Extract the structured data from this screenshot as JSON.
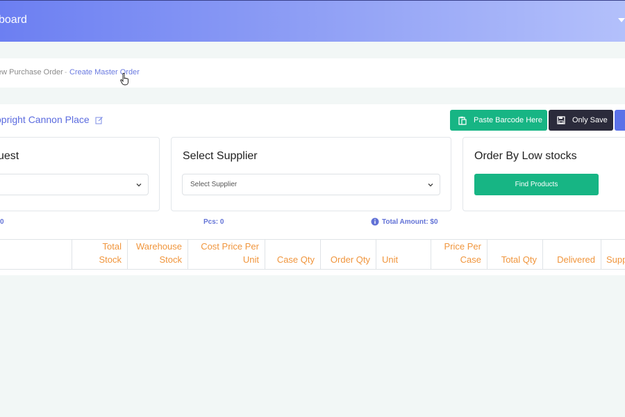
{
  "header": {
    "title": "board"
  },
  "breadcrumb": {
    "items": [
      {
        "label": "ew Purchase Order"
      },
      {
        "label": "Create Master Order"
      }
    ],
    "separator": "-"
  },
  "order": {
    "store_name": "opright Cannon Place",
    "buttons": {
      "paste_barcode": "Paste Barcode Here",
      "only_save": "Only Save"
    },
    "panels": {
      "request": {
        "title": "uest"
      },
      "supplier": {
        "title": "Select Supplier",
        "placeholder": "Select Supplier"
      },
      "low_stock": {
        "title": "Order By Low stocks",
        "button": "Find Products"
      }
    },
    "stats": {
      "first": "0",
      "pcs": "Pcs: 0",
      "total_amount": "Total Amount: $0"
    }
  },
  "table": {
    "columns": [
      {
        "line1": "",
        "line2": ""
      },
      {
        "line1": "Total",
        "line2": "Stock"
      },
      {
        "line1": "Warehouse",
        "line2": "Stock"
      },
      {
        "line1": "Cost Price Per",
        "line2": "Unit"
      },
      {
        "line1": "",
        "line2": "Case Qty"
      },
      {
        "line1": "",
        "line2": "Order Qty"
      },
      {
        "line1": "",
        "line2": "Unit"
      },
      {
        "line1": "Price Per",
        "line2": "Case"
      },
      {
        "line1": "",
        "line2": "Total Qty"
      },
      {
        "line1": "",
        "line2": "Delivered"
      },
      {
        "line1": "",
        "line2": "Supp"
      }
    ]
  },
  "colors": {
    "header_gradient_start": "#6c7ff2",
    "header_gradient_end": "#b3c0fb",
    "primary_green": "#17b584",
    "dark_button": "#2b2b3b",
    "link_blue": "#5b6bdf",
    "column_header_orange": "#f0953c",
    "background": "#f2f7f6"
  },
  "icons": [
    "chevron-down-icon",
    "pointer-cursor-icon",
    "edit-icon",
    "clipboard-icon",
    "save-icon",
    "info-icon"
  ]
}
